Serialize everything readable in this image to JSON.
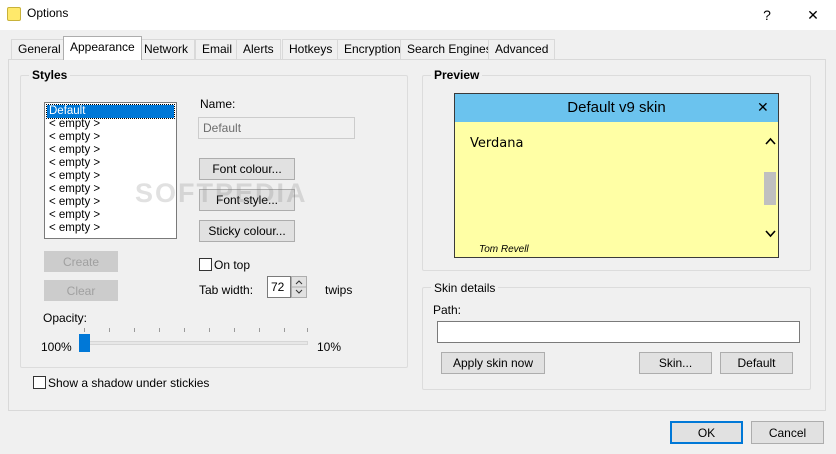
{
  "window": {
    "title": "Options",
    "help_glyph": "?",
    "close_glyph": "✕"
  },
  "tabs": [
    {
      "label": "General"
    },
    {
      "label": "Appearance",
      "active": true
    },
    {
      "label": "Network"
    },
    {
      "label": "Email"
    },
    {
      "label": "Alerts"
    },
    {
      "label": "Hotkeys"
    },
    {
      "label": "Encryption"
    },
    {
      "label": "Search Engines"
    },
    {
      "label": "Advanced"
    }
  ],
  "styles": {
    "group_label": "Styles",
    "items": [
      {
        "label": "Default",
        "selected": true
      },
      {
        "label": "< empty >"
      },
      {
        "label": "< empty >"
      },
      {
        "label": "< empty >"
      },
      {
        "label": "< empty >"
      },
      {
        "label": "< empty >"
      },
      {
        "label": "< empty >"
      },
      {
        "label": "< empty >"
      },
      {
        "label": "< empty >"
      },
      {
        "label": "< empty >"
      }
    ],
    "create_label": "Create",
    "clear_label": "Clear",
    "name_label": "Name:",
    "name_value": "Default",
    "font_colour_label": "Font colour...",
    "font_style_label": "Font style...",
    "sticky_colour_label": "Sticky colour...",
    "on_top_label": "On top",
    "on_top_checked": false,
    "tab_width_label": "Tab width:",
    "tab_width_value": "72",
    "twips_label": "twips",
    "opacity_label": "Opacity:",
    "opacity_max_label": "100%",
    "opacity_min_label": "10%",
    "opacity_value": 1.0
  },
  "shadow": {
    "label": "Show a shadow under stickies",
    "checked": false
  },
  "preview": {
    "group_label": "Preview",
    "skin_title": "Default v9 skin",
    "close_glyph": "✕",
    "font_sample": "Verdana",
    "author": "Tom Revell",
    "scroll_up_glyph": "˄",
    "scroll_down_glyph": "˅",
    "header_color": "#6bc3ee",
    "body_color": "#ffffa5"
  },
  "skin_details": {
    "group_label": "Skin details",
    "path_label": "Path:",
    "path_value": "",
    "apply_label": "Apply skin now",
    "skin_label": "Skin...",
    "default_label": "Default"
  },
  "footer": {
    "ok_label": "OK",
    "cancel_label": "Cancel"
  },
  "watermark": "SOFTPEDIA"
}
